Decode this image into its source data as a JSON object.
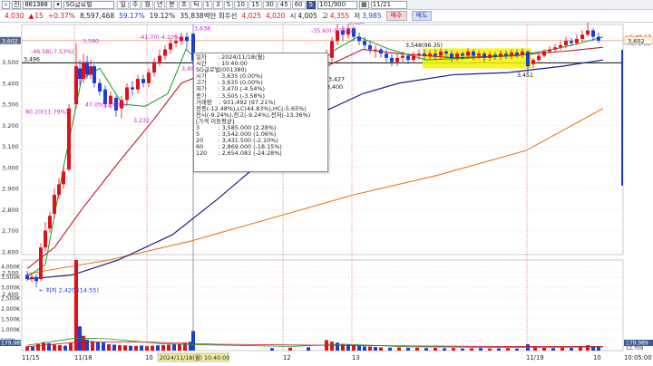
{
  "toolbar": {
    "code": "001380",
    "name": "SG글로벌",
    "periods": [
      "일",
      "주",
      "월",
      "년",
      "분",
      "초",
      "틱",
      "1",
      "3",
      "5",
      "10",
      "15",
      "30",
      "45",
      "60",
      "5"
    ],
    "active_period": "5",
    "count": "101/900",
    "date": "11/21",
    "left_label": "전"
  },
  "quote": {
    "prev": "4,030",
    "change_dir": "▲",
    "change": "15",
    "change_pct": "+0.37%",
    "volume": "8,597,468",
    "ratio": "59.17%",
    "turnover_pct": "19.12%",
    "amount": "35,838백만 회우선",
    "open_label": "4,025",
    "open2": "4,020",
    "high_label": "시",
    "high_val": "4,005",
    "low_label": "고",
    "low_val": "4,355",
    "close_label": "저",
    "close_val": "3,985",
    "buy": "매수",
    "sell": "매도"
  },
  "tooltip": {
    "rows": [
      "일자      : 2024/11/18(월)",
      "시간      : 10:40:00",
      "SG글로벌(001380)",
      "시가      : 3,635 (0.00%)",
      "고가      : 3,635 (0.00%)",
      "저가      : 3,470 (-4.54%)",
      "종가      : 3,505 (-3.58%)",
      "거래량    : 931,492 (97.21%)",
      "전종(-12.48%),LC(44.83%),HC(-5.65%)",
      "전시(-9.24%),전고(-9.24%),전저(-13.36%)",
      "[가격 이동평균]",
      "3          : 3,585.000 (2.28%)",
      "5          : 3,542.000 (1.06%)",
      "20        : 3,431.500 (-2.10%)",
      "60        : 2,869.000 (-18.15%)",
      "120      : 2,654.083 (-24.28%)"
    ]
  },
  "price_axis": {
    "ticks": [
      "3,700",
      "3,600",
      "3,500",
      "3,400",
      "3,300",
      "3,200",
      "3,100",
      "3,000",
      "2,900",
      "2,800",
      "2,700",
      "2,600",
      "2,500",
      "2,400"
    ],
    "current_left": "3,602",
    "current_right": "3,602",
    "left_level": "3,496",
    "lc_label": "LC:49.17",
    "hc_label": "HC:-2.83"
  },
  "volume_axis": {
    "ticks": [
      "4,000K",
      "3,500K",
      "3,000K",
      "2,500K",
      "2,000K",
      "1,500K",
      "1,000K",
      "500K"
    ],
    "current": "179,989",
    "sub": "12,709"
  },
  "time_axis": {
    "labels": [
      "11/15",
      "11/18",
      "10",
      "2024/11/18(월) 10:40:00",
      "12",
      "13",
      "11/19",
      "10",
      "10:05:00"
    ]
  },
  "annotations": {
    "low_marker": "최저 2,420 (14:55)",
    "high_marker": "최고 3,715 (10:00)",
    "a1": "80.10(11.79%)",
    "a2": "-46.58(-7.53%)",
    "a3": "3,590",
    "a4": "47.05(12.06%)",
    "a5": "3,232",
    "a6": "-41.70(-4.10%)",
    "a7": "3,638",
    "a8": "3,494",
    "a9": "-35.60(-5.55%)",
    "a10": "3,680",
    "a11": "3,548(96.35)",
    "a12": "3,427",
    "a13": "3,400",
    "a14": "3,451"
  },
  "colors": {
    "up": "#e0101a",
    "down": "#1a3fd6",
    "ma_green": "#1a9a1a",
    "ma_red": "#c0182a",
    "ma_navy": "#1c1c8a",
    "ma_orange": "#e07a1a",
    "highlight": "#f2f200"
  }
}
